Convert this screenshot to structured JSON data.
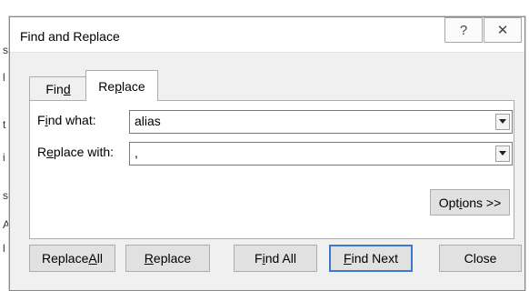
{
  "dialog": {
    "title": "Find and Replace",
    "help_icon": "?",
    "close_icon": "✕"
  },
  "tabs": {
    "find": {
      "pre": "Fin",
      "key": "d",
      "post": ""
    },
    "replace": {
      "pre": "Re",
      "key": "p",
      "post": "lace"
    }
  },
  "fields": {
    "find_what": {
      "label_pre": "F",
      "label_key": "i",
      "label_post": "nd what:",
      "value": "alias"
    },
    "replace_with": {
      "label_pre": "R",
      "label_key": "e",
      "label_post": "place with:",
      "value": ","
    }
  },
  "buttons": {
    "options": {
      "pre": "Opt",
      "key": "i",
      "post": "ons >>"
    },
    "replace_all": {
      "pre": "Replace ",
      "key": "A",
      "post": "ll"
    },
    "replace": {
      "pre": "",
      "key": "R",
      "post": "eplace"
    },
    "find_all": {
      "pre": "F",
      "key": "i",
      "post": "nd All"
    },
    "find_next": {
      "pre": "",
      "key": "F",
      "post": "ind Next"
    },
    "close": "Close"
  },
  "background_edge": [
    "s",
    "l",
    "t",
    "i",
    "s",
    "A",
    "l"
  ]
}
